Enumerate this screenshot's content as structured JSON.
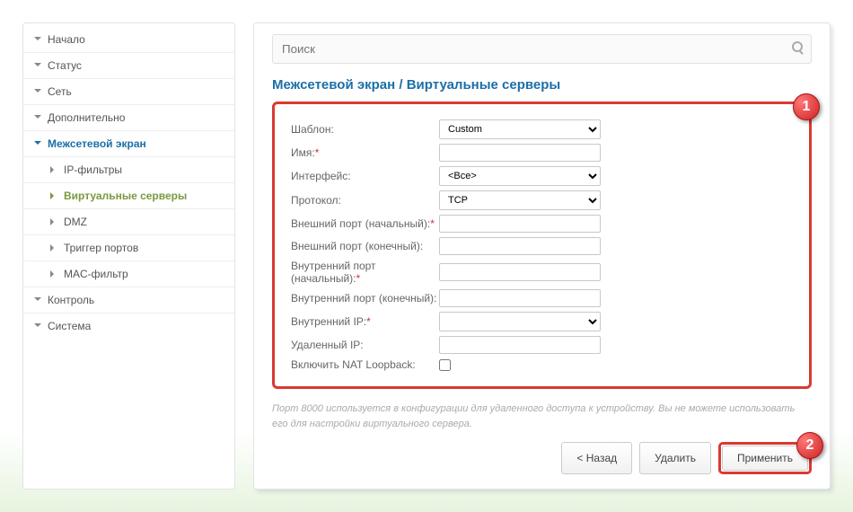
{
  "sidebar": {
    "home": "Начало",
    "status": "Статус",
    "network": "Сеть",
    "advanced": "Дополнительно",
    "firewall": "Межсетевой экран",
    "ipfilters": "IP-фильтры",
    "vservers": "Виртуальные серверы",
    "dmz": "DMZ",
    "ptrigger": "Триггер портов",
    "macfilter": "MAC-фильтр",
    "control": "Контроль",
    "system": "Система"
  },
  "search": {
    "placeholder": "Поиск"
  },
  "breadcrumb": {
    "p1": "Межсетевой экран",
    "sep": " / ",
    "p2": "Виртуальные серверы"
  },
  "form": {
    "template_lbl": "Шаблон:",
    "template_val": "Custom",
    "name_lbl": "Имя:",
    "iface_lbl": "Интерфейс:",
    "iface_val": "<Все>",
    "proto_lbl": "Протокол:",
    "proto_val": "TCP",
    "extstart_lbl": "Внешний порт (начальный):",
    "extend_lbl": "Внешний порт (конечный):",
    "intstart_lbl": "Внутренний порт (начальный):",
    "intend_lbl": "Внутренний порт (конечный):",
    "intip_lbl": "Внутренний IP:",
    "remip_lbl": "Удаленный IP:",
    "natlb_lbl": "Включить NAT Loopback:"
  },
  "note": "Порт 8000 используется в конфигурации для удаленного доступа к устройству. Вы не можете использовать его для настройки виртуального сервера.",
  "btns": {
    "back": "< Назад",
    "delete": "Удалить",
    "apply": "Применить"
  },
  "badges": {
    "one": "1",
    "two": "2"
  }
}
